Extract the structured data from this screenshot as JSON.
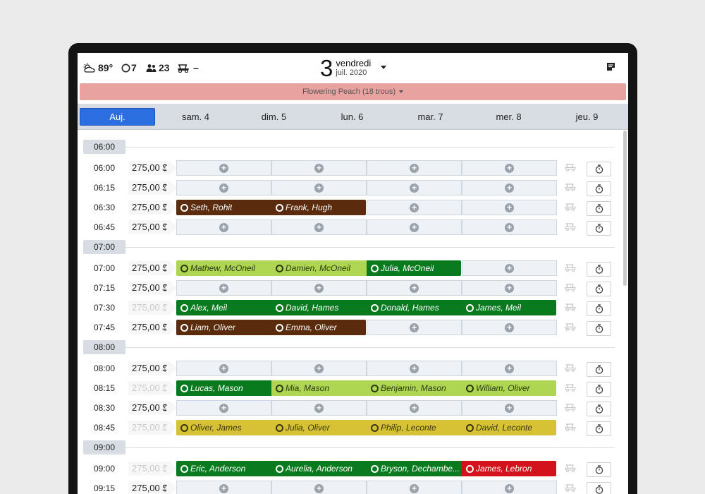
{
  "topbar": {
    "weather": "89°",
    "holes_count": "7",
    "players_count": "23",
    "carts": "–",
    "day_number": "3",
    "day_name": "vendredi",
    "month_year": "juil. 2020"
  },
  "course": {
    "name": "Flowering Peach (18 trous)"
  },
  "day_tabs": [
    "Auj.",
    "sam. 4",
    "dim. 5",
    "lun. 6",
    "mar. 7",
    "mer. 8",
    "jeu. 9"
  ],
  "hours": [
    "06:00",
    "07:00",
    "08:00",
    "09:00"
  ],
  "rows": [
    {
      "time": "06:00",
      "price": "275,00 $",
      "price_faded": false,
      "hour": 0,
      "slots": [
        {
          "t": "open"
        },
        {
          "t": "open"
        },
        {
          "t": "open"
        },
        {
          "t": "open"
        }
      ]
    },
    {
      "time": "06:15",
      "price": "275,00 $",
      "price_faded": false,
      "hour": 0,
      "slots": [
        {
          "t": "open"
        },
        {
          "t": "open"
        },
        {
          "t": "open"
        },
        {
          "t": "open"
        }
      ]
    },
    {
      "time": "06:30",
      "price": "275,00 $",
      "price_faded": false,
      "hour": 0,
      "slots": [
        {
          "t": "booked",
          "name": "Seth, Rohit",
          "color": "brown"
        },
        {
          "t": "booked",
          "name": "Frank, Hugh",
          "color": "brown"
        },
        {
          "t": "open"
        },
        {
          "t": "open"
        }
      ]
    },
    {
      "time": "06:45",
      "price": "275,00 $",
      "price_faded": false,
      "hour": 0,
      "slots": [
        {
          "t": "open"
        },
        {
          "t": "open"
        },
        {
          "t": "open"
        },
        {
          "t": "open"
        }
      ]
    },
    {
      "time": "07:00",
      "price": "275,00 $",
      "price_faded": false,
      "hour": 1,
      "slots": [
        {
          "t": "booked",
          "name": "Mathew, McOneil",
          "color": "lime"
        },
        {
          "t": "booked",
          "name": "Damien, McOneil",
          "color": "lime"
        },
        {
          "t": "booked",
          "name": "Julia, McOneil",
          "color": "green"
        },
        {
          "t": "open"
        }
      ]
    },
    {
      "time": "07:15",
      "price": "275,00 $",
      "price_faded": false,
      "hour": 1,
      "slots": [
        {
          "t": "open"
        },
        {
          "t": "open"
        },
        {
          "t": "open"
        },
        {
          "t": "open"
        }
      ]
    },
    {
      "time": "07:30",
      "price": "275,00 $",
      "price_faded": true,
      "hour": 1,
      "slots": [
        {
          "t": "booked",
          "name": "Alex, Meil",
          "color": "green"
        },
        {
          "t": "booked",
          "name": "David, Hames",
          "color": "green"
        },
        {
          "t": "booked",
          "name": "Donald, Hames",
          "color": "green"
        },
        {
          "t": "booked",
          "name": "James, Meil",
          "color": "green"
        }
      ]
    },
    {
      "time": "07:45",
      "price": "275,00 $",
      "price_faded": false,
      "hour": 1,
      "slots": [
        {
          "t": "booked",
          "name": "Liam, Oliver",
          "color": "brown"
        },
        {
          "t": "booked",
          "name": "Emma, Oliver",
          "color": "brown"
        },
        {
          "t": "open"
        },
        {
          "t": "open"
        }
      ]
    },
    {
      "time": "08:00",
      "price": "275,00 $",
      "price_faded": false,
      "hour": 2,
      "slots": [
        {
          "t": "open"
        },
        {
          "t": "open"
        },
        {
          "t": "open"
        },
        {
          "t": "open"
        }
      ]
    },
    {
      "time": "08:15",
      "price": "275,00 $",
      "price_faded": true,
      "hour": 2,
      "slots": [
        {
          "t": "booked",
          "name": "Lucas, Mason",
          "color": "green"
        },
        {
          "t": "booked",
          "name": "Mia, Mason",
          "color": "lime"
        },
        {
          "t": "booked",
          "name": "Benjamin, Mason",
          "color": "lime"
        },
        {
          "t": "booked",
          "name": "William, Oliver",
          "color": "lime"
        }
      ]
    },
    {
      "time": "08:30",
      "price": "275,00 $",
      "price_faded": false,
      "hour": 2,
      "slots": [
        {
          "t": "open"
        },
        {
          "t": "open"
        },
        {
          "t": "open"
        },
        {
          "t": "open"
        }
      ]
    },
    {
      "time": "08:45",
      "price": "275,00 $",
      "price_faded": true,
      "hour": 2,
      "slots": [
        {
          "t": "booked",
          "name": "Oliver, James",
          "color": "yellow"
        },
        {
          "t": "booked",
          "name": "Julia, Oliver",
          "color": "yellow"
        },
        {
          "t": "booked",
          "name": "Philip, Leconte",
          "color": "yellow"
        },
        {
          "t": "booked",
          "name": "David, Leconte",
          "color": "yellow"
        }
      ]
    },
    {
      "time": "09:00",
      "price": "275,00 $",
      "price_faded": true,
      "hour": 3,
      "slots": [
        {
          "t": "booked",
          "name": "Eric, Anderson",
          "color": "green"
        },
        {
          "t": "booked",
          "name": "Aurelia, Anderson",
          "color": "green"
        },
        {
          "t": "booked",
          "name": "Bryson, Dechambe...",
          "color": "green"
        },
        {
          "t": "booked",
          "name": "James, Lebron",
          "color": "red"
        }
      ]
    },
    {
      "time": "09:15",
      "price": "275,00 $",
      "price_faded": false,
      "hour": 3,
      "slots": [
        {
          "t": "open"
        },
        {
          "t": "open"
        },
        {
          "t": "open"
        },
        {
          "t": "open"
        }
      ]
    }
  ],
  "colors": {
    "brown": "#5a2b0c",
    "lime": "#aed652",
    "green": "#0a7a1f",
    "yellow": "#d6c234",
    "red": "#d3121b",
    "course_bar": "#e8a3a0",
    "active_tab": "#2a6ee0"
  },
  "icons": [
    "cloud-sun-icon",
    "circle-icon",
    "people-icon",
    "golf-cart-icon",
    "notes-icon",
    "plus-circle-icon",
    "stopwatch-icon"
  ]
}
